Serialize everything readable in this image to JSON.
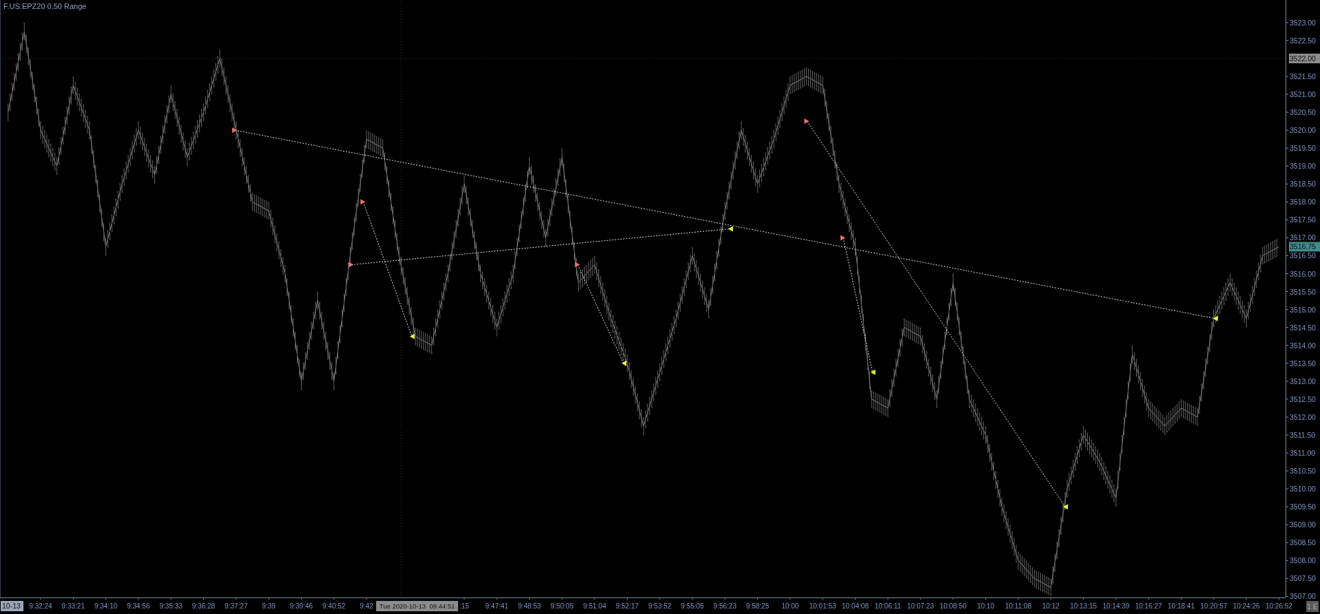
{
  "title": "F.US.EPZ20 0.50 Range",
  "chart_data": {
    "type": "line",
    "ylim": [
      3506.97,
      3523.63
    ],
    "yticks": [
      {
        "value": 3507,
        "label": "3507.00"
      },
      {
        "value": 3507.5,
        "label": "3507.50"
      },
      {
        "value": 3508,
        "label": "3508.00"
      },
      {
        "value": 3508.5,
        "label": "3508.50"
      },
      {
        "value": 3509,
        "label": "3509.00"
      },
      {
        "value": 3509.5,
        "label": "3509.50"
      },
      {
        "value": 3510,
        "label": "3510.00"
      },
      {
        "value": 3510.5,
        "label": "3510.50"
      },
      {
        "value": 3511,
        "label": "3511.00"
      },
      {
        "value": 3511.5,
        "label": "3511.50"
      },
      {
        "value": 3512,
        "label": "3512.00"
      },
      {
        "value": 3512.5,
        "label": "3512.50"
      },
      {
        "value": 3513,
        "label": "3513.00"
      },
      {
        "value": 3513.5,
        "label": "3513.50"
      },
      {
        "value": 3514,
        "label": "3514.00"
      },
      {
        "value": 3514.5,
        "label": "3514.50"
      },
      {
        "value": 3515,
        "label": "3515.00"
      },
      {
        "value": 3515.5,
        "label": "3515.50"
      },
      {
        "value": 3516,
        "label": "3516.00"
      },
      {
        "value": 3516.5,
        "label": "3516.50"
      },
      {
        "value": 3517,
        "label": "3517.00"
      },
      {
        "value": 3517.5,
        "label": "3517.50"
      },
      {
        "value": 3518,
        "label": "3518.00"
      },
      {
        "value": 3518.5,
        "label": "3518.50"
      },
      {
        "value": 3519,
        "label": "3519.00"
      },
      {
        "value": 3519.5,
        "label": "3519.50"
      },
      {
        "value": 3520,
        "label": "3520.00"
      },
      {
        "value": 3520.5,
        "label": "3520.50"
      },
      {
        "value": 3521,
        "label": "3521.00"
      },
      {
        "value": 3521.5,
        "label": "3521.50"
      },
      {
        "value": 3522.5,
        "label": "3522.50"
      },
      {
        "value": 3523,
        "label": "3523.00"
      }
    ],
    "categories": [
      null,
      null,
      "9:32:24",
      null,
      "9:33:21",
      null,
      "9:34:10",
      null,
      "9:34:56",
      null,
      "9:35:33",
      null,
      "9:36:28",
      null,
      "9:37:27",
      null,
      "9:39",
      null,
      "9:39:46",
      null,
      "9:40:52",
      null,
      "9:42",
      null,
      null,
      null,
      null,
      null,
      ":15",
      null,
      "9:47:41",
      null,
      "9:48:53",
      null,
      "9:50:05",
      null,
      "9:51:04",
      null,
      "9:52:17",
      null,
      "9:53:52",
      null,
      "9:55:05",
      null,
      "9:56:23",
      null,
      "9:58:25",
      null,
      "10:00",
      null,
      "10:01:53",
      null,
      "10:04:08",
      null,
      "10:06:11",
      null,
      "10:07:23",
      null,
      "10:08:50",
      null,
      "10:10",
      null,
      "10:11:08",
      null,
      "10:12",
      null,
      "10:13:15",
      null,
      "10:14:39",
      null,
      "10:16:27",
      null,
      "10:18:41",
      null,
      "10:20:57",
      null,
      "10:24:26",
      null,
      "10:26:52"
    ],
    "series": [
      {
        "color": "#8a8a8a",
        "values": [
          3520.5,
          3522.75,
          3520.0,
          3519.0,
          3521.25,
          3520.0,
          3516.75,
          3518.5,
          3520.0,
          3518.75,
          3521.0,
          3519.25,
          3520.5,
          3522.0,
          3520.0,
          3518.0,
          3517.75,
          3516.0,
          3513.0,
          3515.25,
          3513.0,
          3516.5,
          3519.75,
          3519.5,
          3516.5,
          3514.25,
          3514.0,
          3516.0,
          3518.5,
          3516.0,
          3514.5,
          3516.0,
          3519.0,
          3517.0,
          3519.25,
          3515.75,
          3516.25,
          3514.75,
          3513.5,
          3511.75,
          3513.25,
          3514.75,
          3516.5,
          3515.0,
          3517.75,
          3520.0,
          3518.5,
          3519.75,
          3521.25,
          3521.5,
          3521.25,
          3518.5,
          3516.75,
          3512.5,
          3512.25,
          3514.5,
          3514.25,
          3512.5,
          3515.75,
          3512.5,
          3511.5,
          3509.5,
          3508.0,
          3507.5,
          3507.25,
          3510.0,
          3511.5,
          3510.75,
          3509.75,
          3513.75,
          3512.25,
          3511.75,
          3512.25,
          3512.0,
          3514.75,
          3515.75,
          3514.75,
          3516.5,
          3516.75
        ]
      }
    ]
  },
  "crosshair": {
    "price_label": "3522.00",
    "time_label": "Tue 2020-10-13  09:44:51"
  },
  "last_price": {
    "label": "3516.75"
  },
  "date_label": "10-13",
  "corner_button": "1 E"
}
